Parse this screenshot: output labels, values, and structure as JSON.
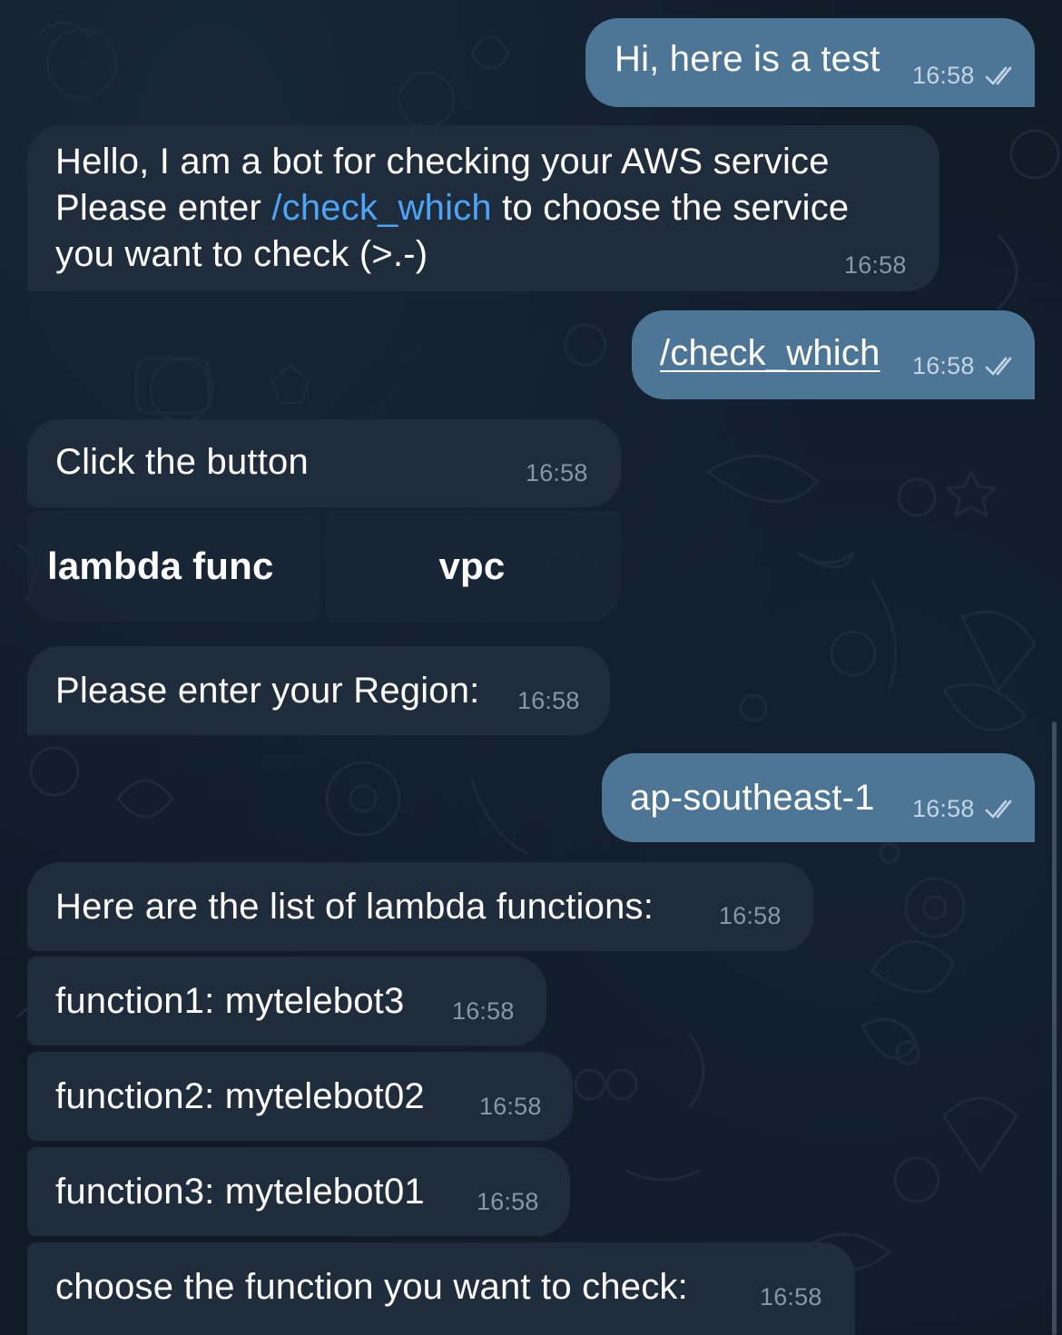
{
  "messages": {
    "m1": {
      "text": "Hi, here is a test",
      "time": "16:58"
    },
    "m2": {
      "line1": "Hello, I am a bot for checking your AWS service",
      "line2_pre": "Please enter ",
      "line2_link": "/check_which",
      "line2_post": " to choose the service",
      "line3": "you want to check (>.-)",
      "time": "16:58"
    },
    "m3": {
      "text": "/check_which",
      "time": "16:58"
    },
    "m4": {
      "text": "Click the button",
      "time": "16:58"
    },
    "m5": {
      "text": "Please enter your Region:",
      "time": "16:58"
    },
    "m6": {
      "text": "ap-southeast-1",
      "time": "16:58"
    },
    "m7": {
      "text": "Here are the list of lambda functions:",
      "time": "16:58"
    },
    "m8": {
      "text": "function1: mytelebot3",
      "time": "16:58"
    },
    "m9": {
      "text": "function2: mytelebot02",
      "time": "16:58"
    },
    "m10": {
      "text": "function3: mytelebot01",
      "time": "16:58"
    },
    "m11": {
      "text": "choose the function you want to check:",
      "time": "16:58"
    }
  },
  "keyboard": {
    "buttons": [
      {
        "label": "lambda func"
      },
      {
        "label": "vpc"
      }
    ]
  },
  "colors": {
    "background": "#0e1621",
    "incoming_bubble": "#1f2c3b",
    "outgoing_bubble": "#4d7596",
    "link": "#4ea4f6",
    "time_incoming": "#8797a8"
  },
  "icons": {
    "read_status": "double-check-icon"
  }
}
